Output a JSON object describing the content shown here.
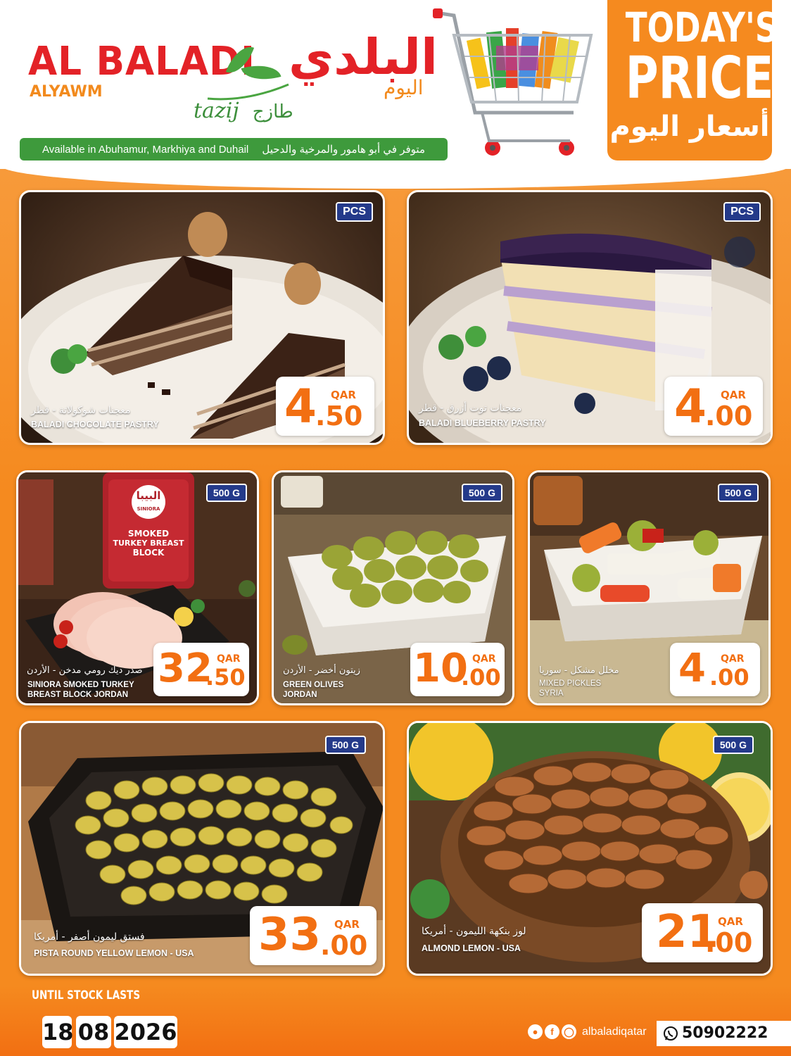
{
  "header": {
    "brand_en": "AL BALADI",
    "brand_sub_en": "ALYAWM",
    "brand_ar": "البلدي",
    "brand_sub_ar": "اليوم",
    "tazij": "tazij",
    "tazij_ar": "طازج",
    "availability_en": "Available in Abuhamur, Markhiya and Duhail",
    "availability_ar": "متوفر في أبو هامور والمرخية والدحيل",
    "today_line1": "TODAY'S",
    "today_line2": "PRICES",
    "today_ar": "أسعار اليوم"
  },
  "products": [
    {
      "badge": "PCS",
      "name_ar": "معجنات شوكولاتة - قطر",
      "name_en": "BALADI CHOCOLATE PASTRY",
      "currency": "QAR",
      "price_int": "4",
      "price_dec": ".50"
    },
    {
      "badge": "PCS",
      "name_ar": "معجنات توت أزرق - قطر",
      "name_en": "BALADI BLUEBERRY PASTRY",
      "currency": "QAR",
      "price_int": "4",
      "price_dec": ".00"
    },
    {
      "badge": "500 G",
      "name_ar": "صدر ديك رومي مدخن - الأردن",
      "name_en": "SINIORA SMOKED TURKEY",
      "name_en2": "BREAST BLOCK JORDAN",
      "currency": "QAR",
      "price_int": "32",
      "price_dec": ".50",
      "pack_ar": "البيبا",
      "pack_brand": "SINIORA",
      "pack_1": "SMOKED",
      "pack_2": "TURKEY BREAST",
      "pack_3": "BLOCK"
    },
    {
      "badge": "500 G",
      "name_ar": "زيتون أخضر - الأردن",
      "name_en": "GREEN OLIVES",
      "name_en2": "JORDAN",
      "currency": "QAR",
      "price_int": "10",
      "price_dec": ".00"
    },
    {
      "badge": "500 G",
      "name_ar": "مخلل مشكل - سوريا",
      "name_en": "MIXED PICKLES",
      "name_en2": "SYRIA",
      "currency": "QAR",
      "price_int": "4",
      "price_dec": ".00"
    },
    {
      "badge": "500 G",
      "name_ar": "فستق ليمون أصفر - أمريكا",
      "name_en": "PISTA ROUND YELLOW LEMON - USA",
      "currency": "QAR",
      "price_int": "33",
      "price_dec": ".00"
    },
    {
      "badge": "500 G",
      "name_ar": "لوز بنكهة الليمون - أمريكا",
      "name_en": "ALMOND LEMON - USA",
      "currency": "QAR",
      "price_int": "21",
      "price_dec": ".00"
    }
  ],
  "footer": {
    "until": "UNTIL STOCK LASTS",
    "date_day": "18",
    "date_month": "08",
    "date_year": "2026",
    "social_handle": "albaladiqatar",
    "phone": "50902222"
  }
}
